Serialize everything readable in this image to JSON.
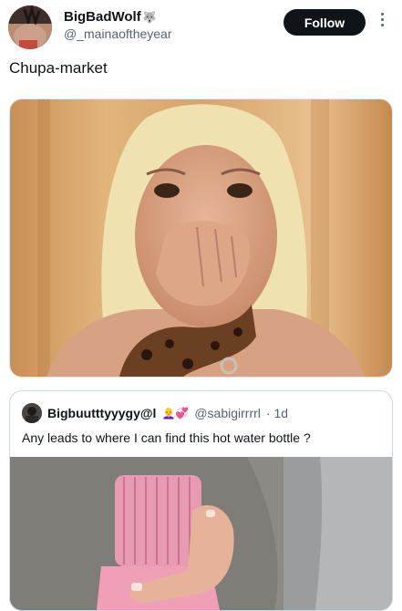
{
  "post": {
    "author": {
      "display_name": "BigBadWolf",
      "name_emoji": "🐺",
      "handle": "@_mainaoftheyear"
    },
    "follow_label": "Follow",
    "text": "Chupa-market"
  },
  "quote": {
    "author": {
      "display_name": "Bigbuutttyyygy@l",
      "name_emoji": "👩‍🦲💞",
      "handle": "@sabigirrrrl",
      "time": "· 1d"
    },
    "text": "Any leads to where I can find this hot water bottle ?"
  },
  "icons": {
    "more": "more-vertical-icon"
  }
}
